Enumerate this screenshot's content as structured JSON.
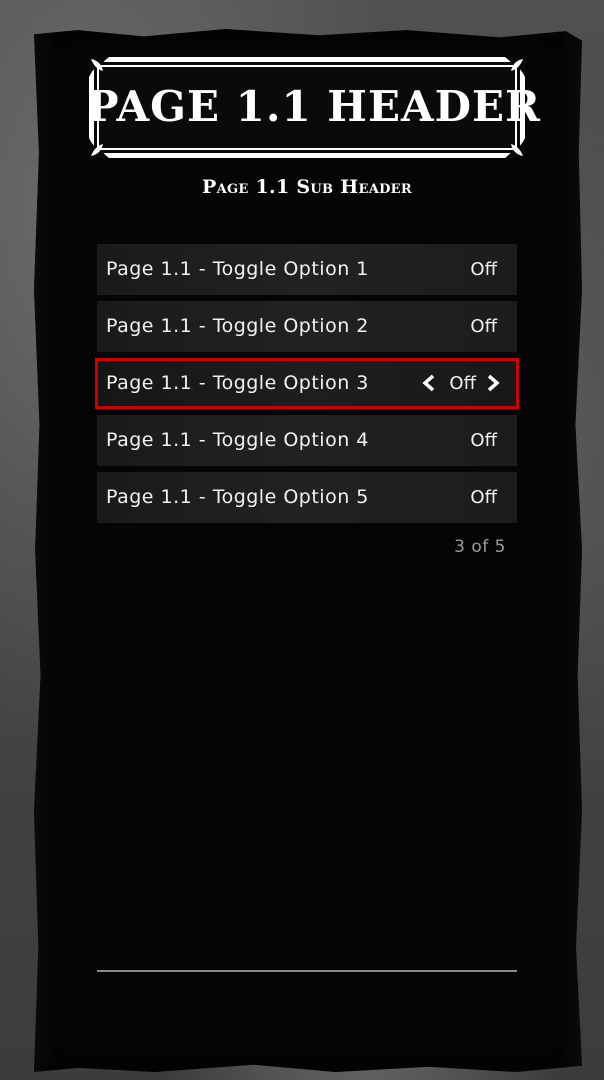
{
  "header": {
    "title": "PAGE 1.1 HEADER",
    "sub_header": "Page 1.1 Sub Header"
  },
  "options": [
    {
      "label": "Page 1.1 - Toggle Option 1",
      "value": "Off",
      "selected": false
    },
    {
      "label": "Page 1.1 - Toggle Option 2",
      "value": "Off",
      "selected": false
    },
    {
      "label": "Page 1.1 - Toggle Option 3",
      "value": "Off",
      "selected": true
    },
    {
      "label": "Page 1.1 - Toggle Option 4",
      "value": "Off",
      "selected": false
    },
    {
      "label": "Page 1.1 - Toggle Option 5",
      "value": "Off",
      "selected": false
    }
  ],
  "pager": {
    "text": "3 of 5"
  },
  "colors": {
    "selection_border": "#cc0000",
    "text": "#f2f2f2",
    "pager_text": "#9a9a9a"
  },
  "icons": {
    "left": "chevron-left-icon",
    "right": "chevron-right-icon"
  }
}
